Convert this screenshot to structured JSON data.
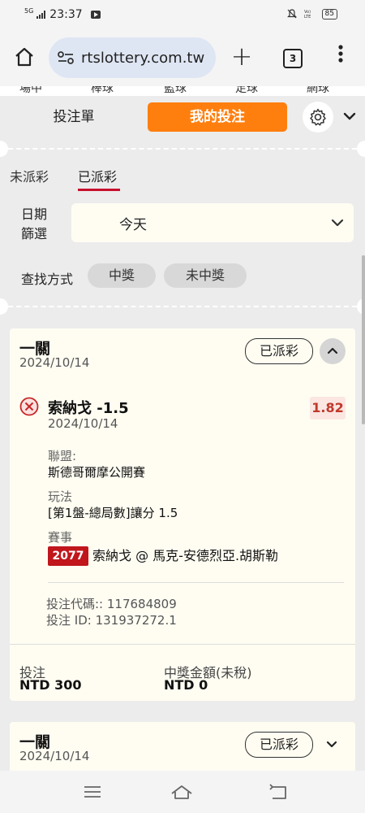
{
  "status_bar": {
    "network": "5G",
    "time": "23:37",
    "battery": "85"
  },
  "browser": {
    "url": "rtslottery.com.tw",
    "tab_count": "3",
    "new_tab_label": "+"
  },
  "nav_cut": [
    "場中",
    "棒球",
    "籃球",
    "足球",
    "網球"
  ],
  "header": {
    "tab_betslip": "投注單",
    "tab_mybets": "我的投注"
  },
  "sub_tabs": {
    "unsettled": "未派彩",
    "settled": "已派彩"
  },
  "filter": {
    "date_label": "日期篩選",
    "date_value": "今天",
    "search_label": "查找方式",
    "chip_win": "中獎",
    "chip_lose": "未中獎"
  },
  "cards": [
    {
      "title": "一關",
      "date": "2024/10/14",
      "status": "已派彩",
      "selection": {
        "name": "索納戈 -1.5",
        "date": "2024/10/14",
        "odds": "1.82",
        "league_label": "聯盟:",
        "league": "斯德哥爾摩公開賽",
        "market_label": "玩法",
        "market": "[第1盤-總局數]讓分 1.5",
        "event_label": "賽事",
        "event_code": "2077",
        "event_name": "索納戈 @ 馬克-安德烈亞.胡斯勒"
      },
      "bet_code": "投注代碼:: 117684809",
      "bet_id": "投注 ID: 131937272.1",
      "stake_label": "投注",
      "stake": "NTD 300",
      "payout_label": "中獎金額(未稅)",
      "payout": "NTD 0"
    },
    {
      "title": "一關",
      "date": "2024/10/14",
      "status": "已派彩"
    }
  ],
  "colors": {
    "accent_orange": "#ff7f0e",
    "underline_red": "#c8102e",
    "code_red": "#c0161c",
    "odds_red": "#c0392b",
    "card_bg": "#fffdf2"
  }
}
